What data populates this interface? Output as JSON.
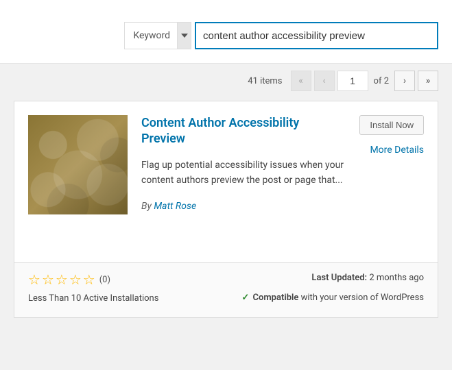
{
  "search": {
    "dropdown_label": "Keyword",
    "input_value": "content author accessibility preview"
  },
  "pagination": {
    "items_text": "41 items",
    "current_page": "1",
    "total_text": "of 2"
  },
  "plugin": {
    "title": "Content Author Accessibility Preview",
    "description": "Flag up potential accessibility issues when your content authors preview the post or page that...",
    "author_prefix": "By ",
    "author_name": "Matt Rose",
    "install_label": "Install Now",
    "more_details": "More Details",
    "rating_count": "(0)",
    "installations": "Less Than 10 Active Installations",
    "last_updated_label": "Last Updated:",
    "last_updated_value": "2 months ago",
    "compatible_label": "Compatible",
    "compatible_text": " with your version of WordPress"
  }
}
